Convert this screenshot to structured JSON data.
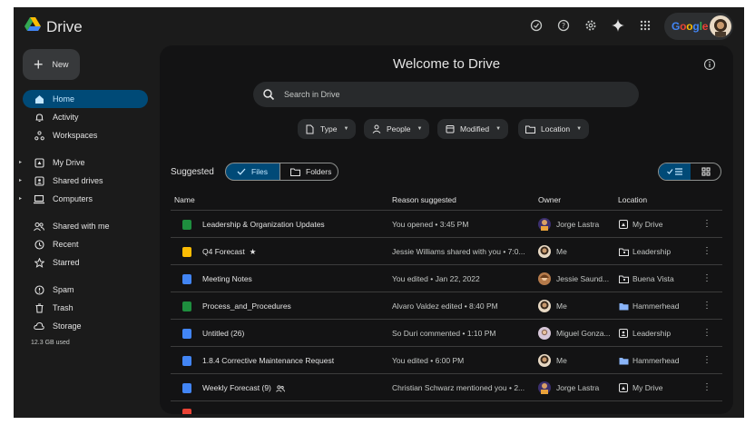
{
  "app": {
    "name": "Drive"
  },
  "account": {
    "brand": "Google"
  },
  "colors": {
    "accent_active": "#004a77",
    "accent_text": "#c2e7ff",
    "sheets_green": "#1e8e3e",
    "docs_blue": "#4285f4",
    "slides_yellow": "#fbbc04"
  },
  "topbar_icons": [
    "offline-status-icon",
    "help-icon",
    "settings-icon",
    "gemini-sparkle-icon",
    "apps-grid-icon"
  ],
  "sidebar": {
    "new_label": "New",
    "items": [
      {
        "label": "Home",
        "icon": "home-icon"
      },
      {
        "label": "Activity",
        "icon": "bell-icon"
      },
      {
        "label": "Workspaces",
        "icon": "workspaces-icon"
      },
      {
        "label": "My Drive",
        "icon": "my-drive-icon"
      },
      {
        "label": "Shared drives",
        "icon": "shared-drives-icon"
      },
      {
        "label": "Computers",
        "icon": "computer-icon"
      },
      {
        "label": "Shared with me",
        "icon": "people-icon"
      },
      {
        "label": "Recent",
        "icon": "clock-icon"
      },
      {
        "label": "Starred",
        "icon": "star-icon"
      },
      {
        "label": "Spam",
        "icon": "spam-icon"
      },
      {
        "label": "Trash",
        "icon": "trash-icon"
      },
      {
        "label": "Storage",
        "icon": "cloud-icon"
      }
    ],
    "storage_used": "12.3 GB used"
  },
  "main": {
    "title": "Welcome to Drive",
    "search_placeholder": "Search in Drive",
    "filters": [
      "Type",
      "People",
      "Modified",
      "Location"
    ],
    "suggested_label": "Suggested",
    "files_toggle": "Files",
    "folders_toggle": "Folders",
    "columns": {
      "name": "Name",
      "reason": "Reason suggested",
      "owner": "Owner",
      "location": "Location"
    }
  },
  "rows": [
    {
      "name": "Leadership & Organization Updates",
      "type": "sheets",
      "reason": "You opened • 3:45 PM",
      "owner": "Jorge Lastra",
      "location": "My Drive",
      "location_icon": "my-drive-icon"
    },
    {
      "name": "Q4 Forecast",
      "type": "slides",
      "starred": true,
      "reason": "Jessie Williams shared with you • 7:0...",
      "owner": "Me",
      "location": "Leadership",
      "location_icon": "shared-folder-icon"
    },
    {
      "name": "Meeting Notes",
      "type": "docs",
      "reason": "You edited • Jan 22, 2022",
      "owner": "Jessie Saund...",
      "location": "Buena Vista",
      "location_icon": "shared-folder-icon"
    },
    {
      "name": "Process_and_Procedures",
      "type": "sheets",
      "reason": "Alvaro Valdez edited • 8:40 PM",
      "owner": "Me",
      "location": "Hammerhead",
      "location_icon": "folder-icon"
    },
    {
      "name": "Untitled (26)",
      "type": "docs",
      "reason": "So Duri commented • 1:10 PM",
      "owner": "Miguel Gonza...",
      "location": "Leadership",
      "location_icon": "shared-drive-icon"
    },
    {
      "name": "1.8.4 Corrective Maintenance Request",
      "type": "docs",
      "reason": "You edited • 6:00 PM",
      "owner": "Me",
      "location": "Hammerhead",
      "location_icon": "folder-icon"
    },
    {
      "name": "Weekly Forecast (9)",
      "type": "docs",
      "shared": true,
      "reason": "Christian Schwarz mentioned you • 2...",
      "owner": "Jorge Lastra",
      "location": "My Drive",
      "location_icon": "my-drive-icon"
    }
  ]
}
